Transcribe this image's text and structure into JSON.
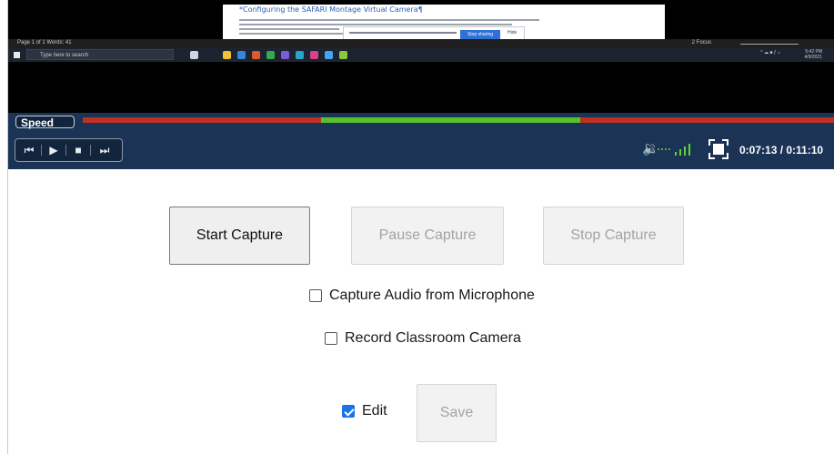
{
  "player": {
    "screen_title": "*Configuring the SAFARI Montage Virtual Camera¶",
    "screen_dialog_button": "Stop sharing",
    "screen_dialog_close": "Hide",
    "screen_status_left": "Page 1 of 1    Words: 41",
    "screen_status_right": "2 Focus",
    "screen_search_placeholder": "Type here to search",
    "screen_tray_text": "^ ☁ ■ ƒ ⌂",
    "screen_clock": "5:42 PM\n4/9/2021",
    "speed_label": "Speed",
    "speed_range_start": 0.317,
    "speed_range_end": 0.6617,
    "time": "0:07:13 / 0:11:10",
    "volume_icon": "🔉",
    "volume_dots": "....",
    "transport": {
      "prev_icon": "⏮",
      "play_icon": "▶",
      "stop_icon": "■",
      "next_icon": "⏭"
    }
  },
  "capture": {
    "start_label": "Start Capture",
    "pause_label": "Pause Capture",
    "stop_label": "Stop Capture"
  },
  "options": {
    "audio_label": "Capture Audio from Microphone",
    "audio_checked": false,
    "camera_label": "Record Classroom Camera",
    "camera_checked": false,
    "edit_label": "Edit",
    "edit_checked": true,
    "save_label": "Save"
  },
  "colors": {
    "player_bg": "#1b3456",
    "speed_track": "#c0301f",
    "speed_fill": "#55c22b",
    "checkbox_accent": "#1a73e8"
  }
}
